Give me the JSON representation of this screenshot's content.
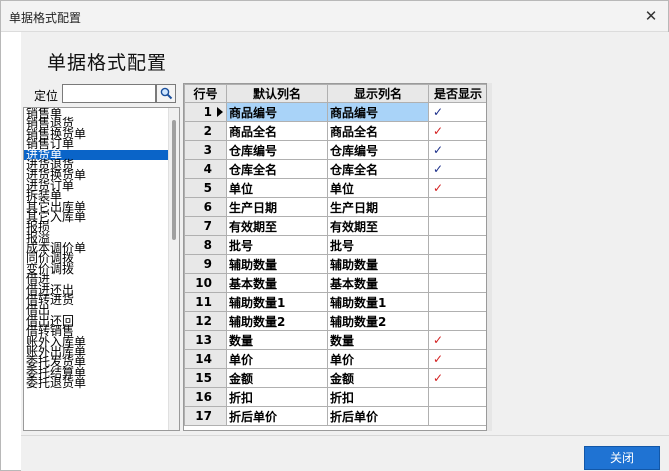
{
  "window": {
    "title": "单据格式配置",
    "close_glyph": "✕"
  },
  "heading": "单据格式配置",
  "locate": {
    "label": "定位",
    "value": ""
  },
  "bill_list": {
    "selected_index": 4,
    "items": [
      "销售单",
      "销售退货",
      "销售换货单",
      "销售订单",
      "进货单",
      "进货退货",
      "进货换货单",
      "进货订单",
      "拆装单",
      "其它出库单",
      "其它入库单",
      "报损",
      "报溢",
      "成本调价单",
      "同价调拨",
      "变价调拨",
      "借进",
      "借进还出",
      "借转进货",
      "借出",
      "借出还回",
      "借转销售",
      "账外入库单",
      "账外出库单",
      "委托发货单",
      "委托结算单",
      "委托退货单"
    ]
  },
  "grid": {
    "headers": [
      "行号",
      "默认列名",
      "显示列名",
      "是否显示"
    ],
    "selected_row": 1,
    "rows": [
      {
        "no": "1",
        "default": "商品编号",
        "display": "商品编号",
        "show": "✓"
      },
      {
        "no": "2",
        "default": "商品全名",
        "display": "商品全名",
        "show": "✓"
      },
      {
        "no": "3",
        "default": "仓库编号",
        "display": "仓库编号",
        "show": "✓"
      },
      {
        "no": "4",
        "default": "仓库全名",
        "display": "仓库全名",
        "show": "✓"
      },
      {
        "no": "5",
        "default": "单位",
        "display": "单位",
        "show": "✓"
      },
      {
        "no": "6",
        "default": "生产日期",
        "display": "生产日期",
        "show": ""
      },
      {
        "no": "7",
        "default": "有效期至",
        "display": "有效期至",
        "show": ""
      },
      {
        "no": "8",
        "default": "批号",
        "display": "批号",
        "show": ""
      },
      {
        "no": "9",
        "default": "辅助数量",
        "display": "辅助数量",
        "show": ""
      },
      {
        "no": "10",
        "default": "基本数量",
        "display": "基本数量",
        "show": ""
      },
      {
        "no": "11",
        "default": "辅助数量1",
        "display": "辅助数量1",
        "show": ""
      },
      {
        "no": "12",
        "default": "辅助数量2",
        "display": "辅助数量2",
        "show": ""
      },
      {
        "no": "13",
        "default": "数量",
        "display": "数量",
        "show": "✓"
      },
      {
        "no": "14",
        "default": "单价",
        "display": "单价",
        "show": "✓"
      },
      {
        "no": "15",
        "default": "金额",
        "display": "金额",
        "show": "✓"
      },
      {
        "no": "16",
        "default": "折扣",
        "display": "折扣",
        "show": ""
      },
      {
        "no": "17",
        "default": "折后单价",
        "display": "折后单价",
        "show": ""
      }
    ],
    "check_colors": [
      "#1c2f8a",
      "#d42020",
      "#1c2f8a",
      "#1c2f8a",
      "#d42020",
      "",
      "",
      "",
      "",
      "",
      "",
      "",
      "#d42020",
      "#d42020",
      "#d42020",
      "",
      ""
    ]
  },
  "buttons": {
    "close_label": "关闭"
  },
  "colors": {
    "selection": "#0a64c8",
    "selected_row": "#a9d3f8",
    "primary_button": "#1f73d3"
  }
}
